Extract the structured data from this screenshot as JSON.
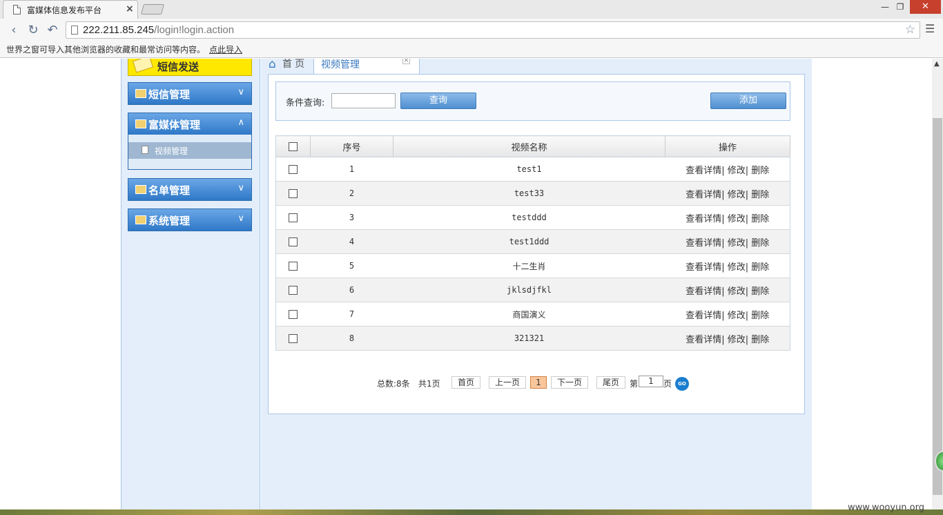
{
  "browser": {
    "tab_title": "富媒体信息发布平台",
    "tab_close": "×",
    "url_host": "222.211.85.245",
    "url_path": "/login!login.action",
    "bookmark_message": "世界之窗可导入其他浏览器的收藏和最常访问等内容。",
    "bookmark_import": "点此导入",
    "win_min": "—",
    "win_restore": "❐",
    "win_close": "✕"
  },
  "sidebar": {
    "sms_send": "短信发送",
    "groups": [
      {
        "label": "短信管理",
        "expanded": false
      },
      {
        "label": "富媒体管理",
        "expanded": true,
        "items": [
          {
            "label": "视频管理"
          }
        ]
      },
      {
        "label": "名单管理",
        "expanded": false
      },
      {
        "label": "系统管理",
        "expanded": false
      }
    ]
  },
  "tabs": {
    "home": "首页",
    "video": "视频管理",
    "video_close": "×"
  },
  "search": {
    "label": "条件查询:",
    "value": "",
    "query_button": "查询",
    "add_button": "添加"
  },
  "table": {
    "headers": [
      "序号",
      "视频名称",
      "操作"
    ],
    "rows": [
      {
        "no": "1",
        "name": "test1"
      },
      {
        "no": "2",
        "name": "test33"
      },
      {
        "no": "3",
        "name": "testddd"
      },
      {
        "no": "4",
        "name": "test1ddd"
      },
      {
        "no": "5",
        "name": "十二生肖"
      },
      {
        "no": "6",
        "name": "jklsdjfkl"
      },
      {
        "no": "7",
        "name": "商国演义"
      },
      {
        "no": "8",
        "name": "321321"
      }
    ],
    "op_detail": "查看详情",
    "op_edit": "修改",
    "op_delete": "删除",
    "op_sep": "|"
  },
  "pager": {
    "total": "总数:8条",
    "pages": "共1页",
    "first": "首页",
    "prev": "上一页",
    "current": "1",
    "next": "下一页",
    "last": "尾页",
    "goto_prefix": "第",
    "goto_value": "1",
    "goto_suffix": "页",
    "go": "GO"
  },
  "watermark": "www.wooyun.org",
  "colors": {
    "accent": "#2f78c8",
    "sms_yellow": "#ffe800",
    "panel_bg": "#e3eefa",
    "current_page": "#f9c69c"
  }
}
